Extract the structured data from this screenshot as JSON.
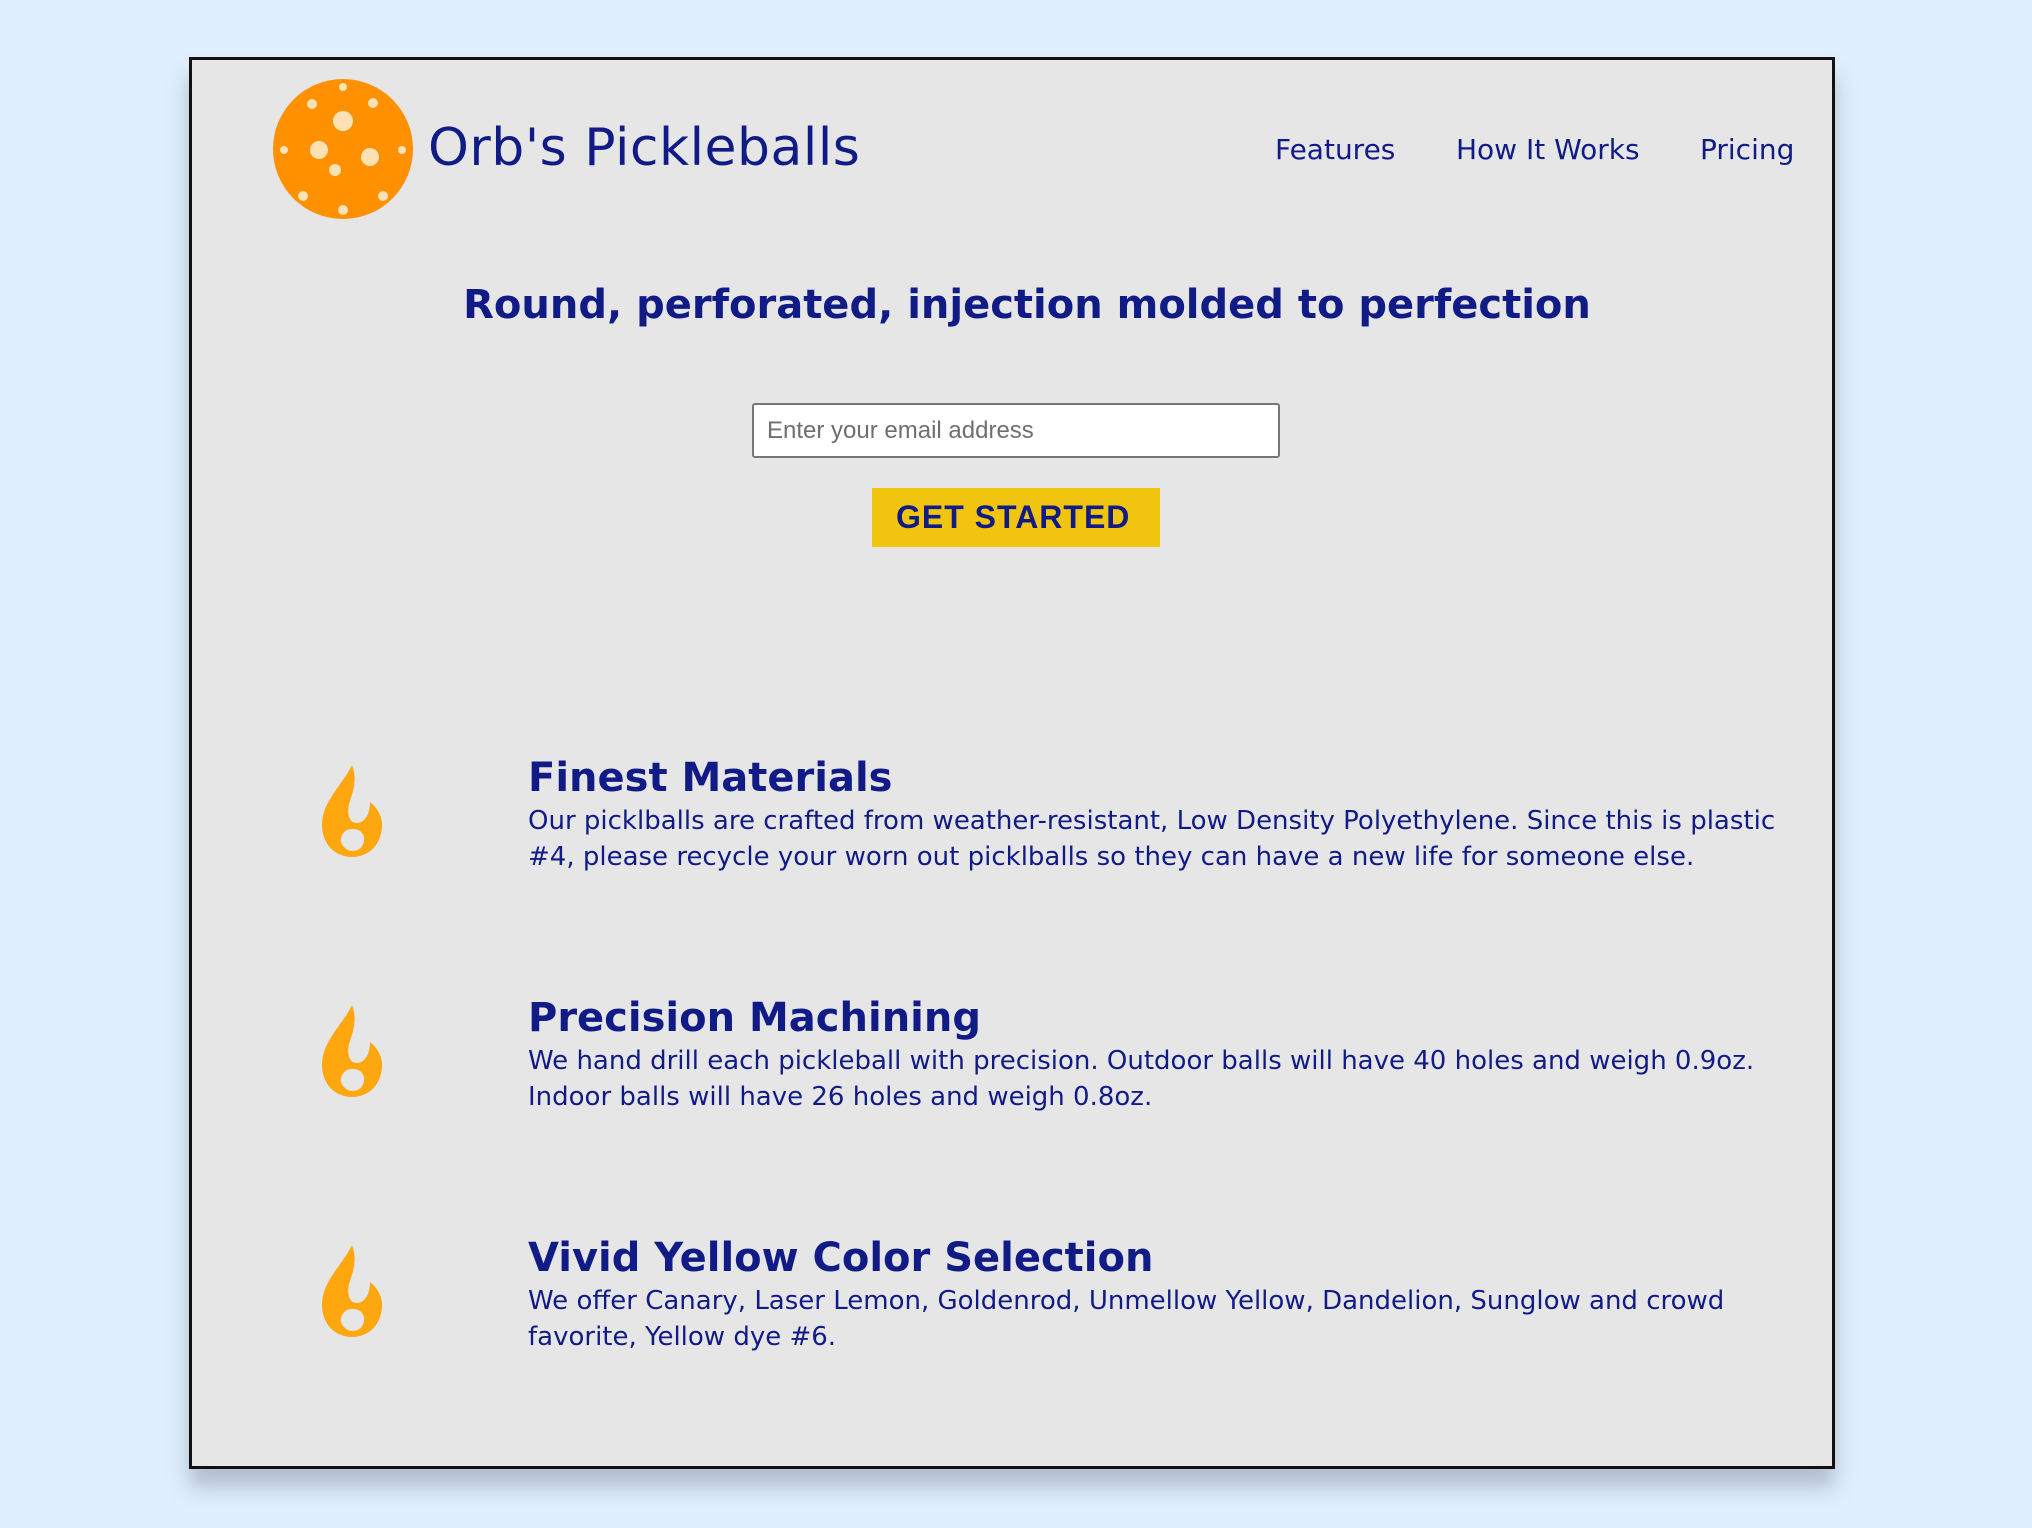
{
  "header": {
    "brand": "Orb's Pickleballs",
    "nav": [
      "Features",
      "How It Works",
      "Pricing"
    ]
  },
  "hero": {
    "title": "Round, perforated, injection molded to perfection",
    "email_placeholder": "Enter your email address",
    "cta_label": "GET STARTED"
  },
  "features": [
    {
      "icon": "flame-icon",
      "title": "Finest Materials",
      "description": "Our picklballs are crafted from weather-resistant, Low Density Polyethylene. Since this is plastic #4, please recycle your worn out picklballs so they can have a new life for someone else."
    },
    {
      "icon": "flame-icon",
      "title": "Precision Machining",
      "description": "We hand drill each pickleball with precision. Outdoor balls will have 40 holes and weigh 0.9oz. Indoor balls will have 26 holes and weigh 0.8oz."
    },
    {
      "icon": "flame-icon",
      "title": "Vivid Yellow Color Selection",
      "description": "We offer Canary, Laser Lemon, Goldenrod, Unmellow Yellow, Dandelion, Sunglow and crowd favorite, Yellow dye #6."
    }
  ],
  "colors": {
    "page_background": "#e0effd",
    "content_background": "#e6e6e6",
    "text": "#111b86",
    "cta": "#f1c40f",
    "logo": "#ff9000",
    "flame": "#ffa70f"
  }
}
